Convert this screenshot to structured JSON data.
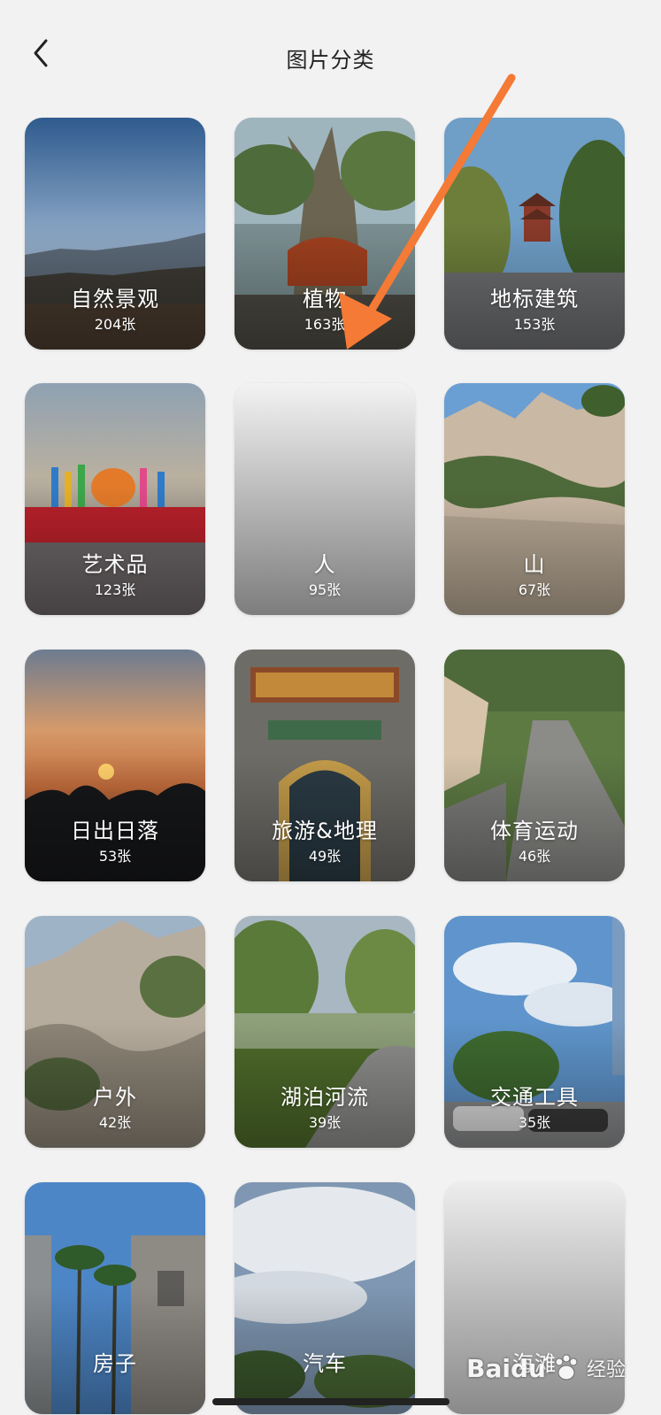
{
  "header": {
    "title": "图片分类"
  },
  "categories": [
    {
      "name": "自然景观",
      "count": "204张"
    },
    {
      "name": "植物",
      "count": "163张"
    },
    {
      "name": "地标建筑",
      "count": "153张"
    },
    {
      "name": "艺术品",
      "count": "123张"
    },
    {
      "name": "人",
      "count": "95张"
    },
    {
      "name": "山",
      "count": "67张"
    },
    {
      "name": "日出日落",
      "count": "53张"
    },
    {
      "name": "旅游&地理",
      "count": "49张"
    },
    {
      "name": "体育运动",
      "count": "46张"
    },
    {
      "name": "户外",
      "count": "42张"
    },
    {
      "name": "湖泊河流",
      "count": "39张"
    },
    {
      "name": "交通工具",
      "count": "35张"
    },
    {
      "name": "房子",
      "count": ""
    },
    {
      "name": "汽车",
      "count": ""
    },
    {
      "name": "海滩",
      "count": ""
    }
  ],
  "watermark": {
    "brand": "Baidu",
    "label": "经验"
  },
  "colors": {
    "background": "#f2f2f2",
    "arrow": "#f47a35",
    "text": "#222222"
  },
  "icons": {
    "back": "chevron-left-icon",
    "watermark": "baidu-paw-icon"
  }
}
